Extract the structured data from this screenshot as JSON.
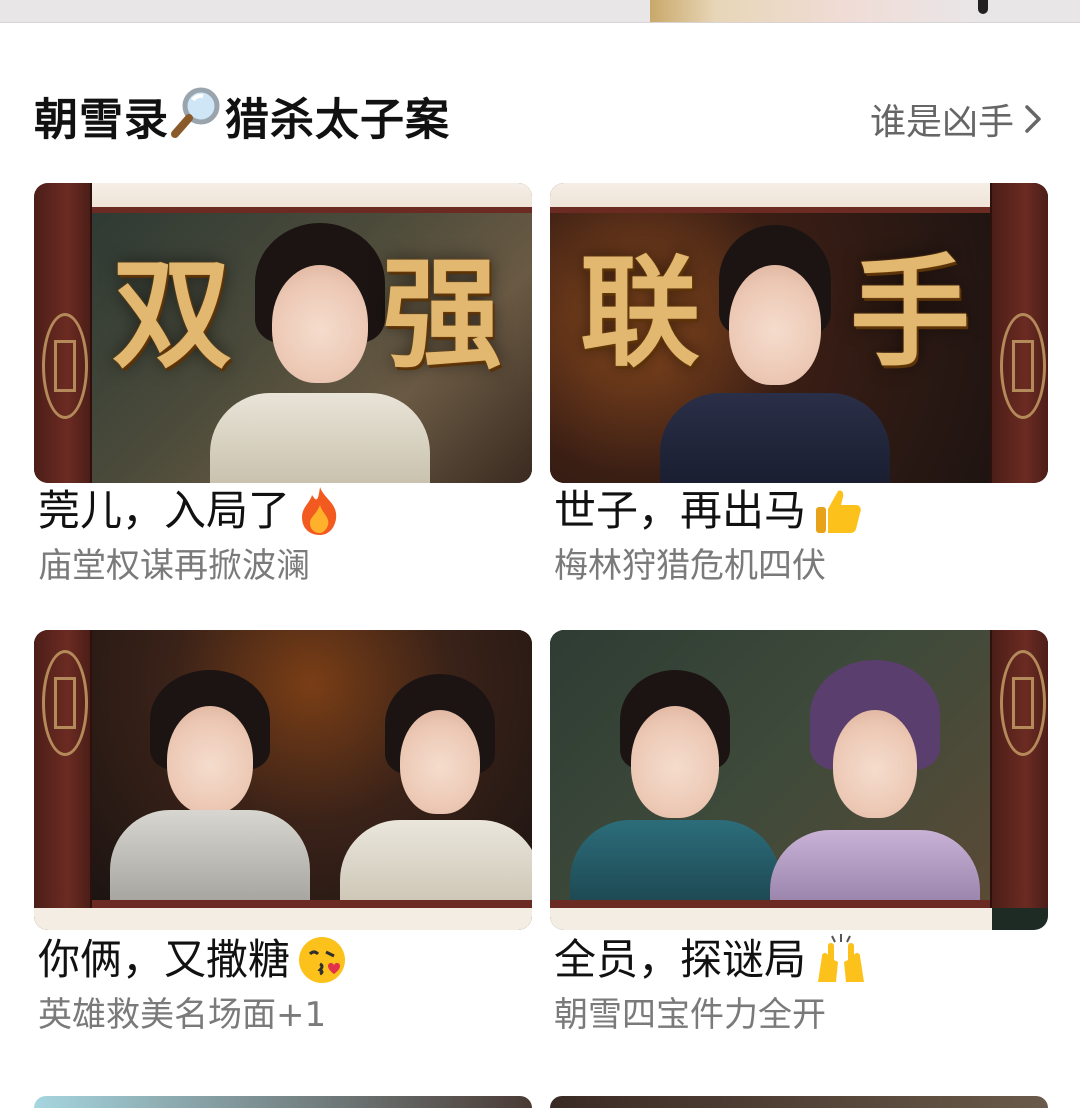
{
  "section": {
    "title_prefix": "朝雪录",
    "title_suffix": "猎杀太子案",
    "more_label": "谁是凶手"
  },
  "cards": [
    {
      "overlay_text": [
        "双",
        "强"
      ],
      "title": "莞儿，入局了",
      "emoji": "fire-emoji",
      "subtitle": "庙堂权谋再掀波澜"
    },
    {
      "overlay_text": [
        "联",
        "手"
      ],
      "title": "世子，再出马",
      "emoji": "thumbs-up-emoji",
      "subtitle": "梅林狩猎危机四伏"
    },
    {
      "overlay_text": [],
      "title": "你俩，又撒糖",
      "emoji": "kiss-face-emoji",
      "subtitle": "英雄救美名场面+1"
    },
    {
      "overlay_text": [],
      "title": "全员，探谜局",
      "emoji": "raised-hands-emoji",
      "subtitle": "朝雪四宝件力全开"
    }
  ],
  "icons": {
    "title_icon": "magnifier-icon",
    "more_icon": "chevron-right-icon"
  },
  "colors": {
    "door": "#6b2b22",
    "calligraphy": "#e2b770",
    "subtitle": "#7a7a7a"
  }
}
